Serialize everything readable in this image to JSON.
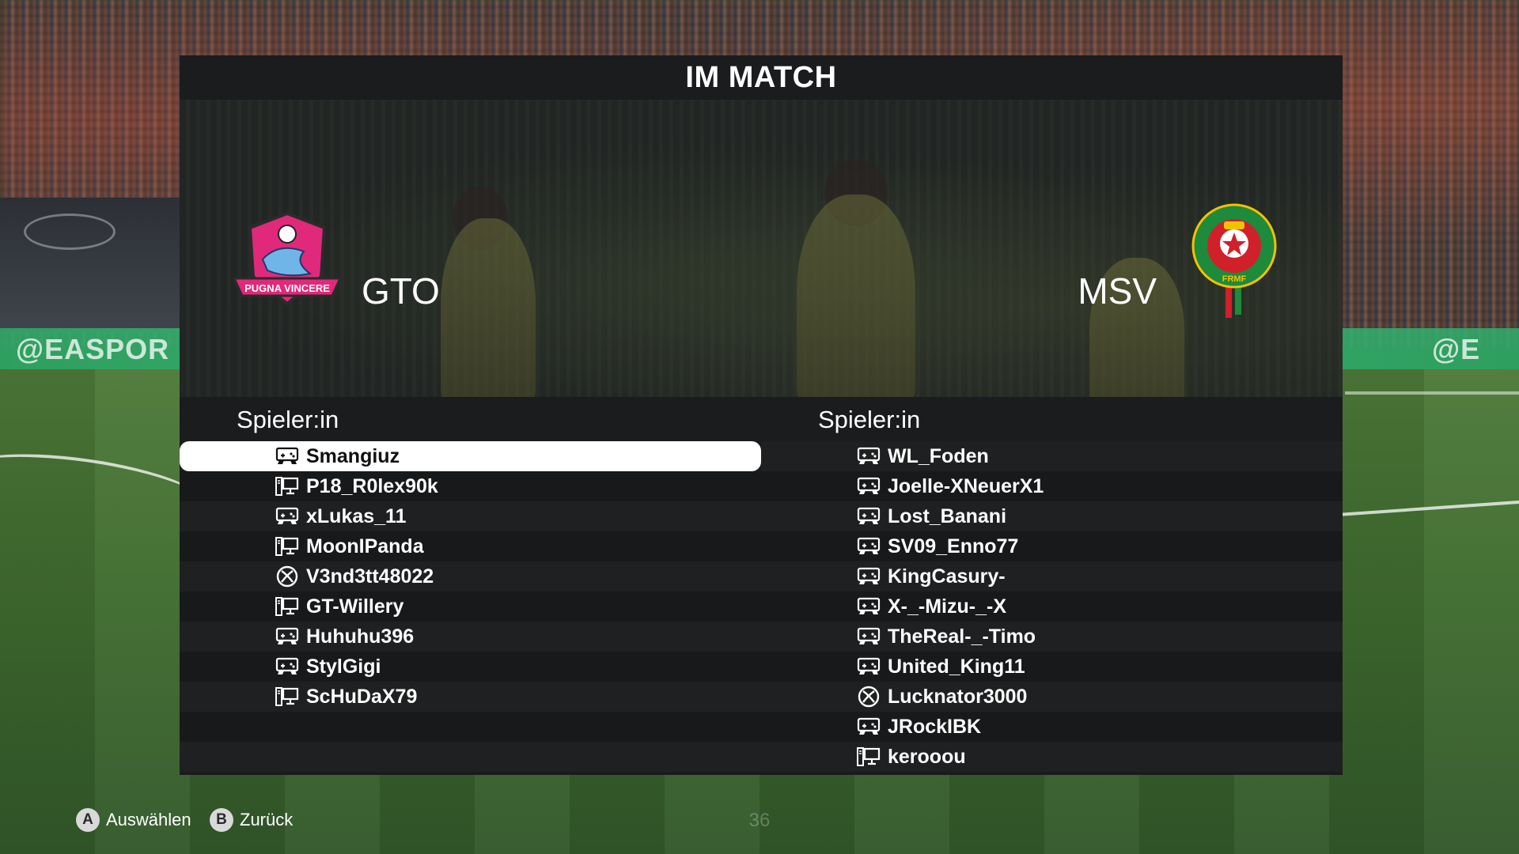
{
  "title": "IM MATCH",
  "teams": {
    "home": {
      "name": "GTO",
      "crest_text": "PUGNA VINCERE",
      "crest_colors": [
        "#e02a7a",
        "#6fb5e8",
        "#2b2b2b"
      ]
    },
    "away": {
      "name": "MSV",
      "crest_text": "FRMF",
      "crest_colors": [
        "#1e8a3c",
        "#d0202a",
        "#f2c200"
      ]
    }
  },
  "columns": {
    "left_header": "Spieler:in",
    "right_header": "Spieler:in"
  },
  "home_players": [
    {
      "name": "Smangiuz",
      "platform": "console-icon",
      "selected": true
    },
    {
      "name": "P18_R0lex90k",
      "platform": "pc-icon"
    },
    {
      "name": "xLukas_11",
      "platform": "console-icon"
    },
    {
      "name": "MoonIPanda",
      "platform": "pc-icon"
    },
    {
      "name": "V3nd3tt48022",
      "platform": "xbox-icon"
    },
    {
      "name": "GT-Willery",
      "platform": "pc-icon"
    },
    {
      "name": "Huhuhu396",
      "platform": "console-icon"
    },
    {
      "name": "StylGigi",
      "platform": "console-icon"
    },
    {
      "name": "ScHuDaX79",
      "platform": "pc-icon"
    }
  ],
  "away_players": [
    {
      "name": "WL_Foden",
      "platform": "console-icon"
    },
    {
      "name": "Joelle-XNeuerX1",
      "platform": "console-icon"
    },
    {
      "name": "Lost_Banani",
      "platform": "console-icon"
    },
    {
      "name": "SV09_Enno77",
      "platform": "console-icon"
    },
    {
      "name": "KingCasury-",
      "platform": "console-icon"
    },
    {
      "name": "X-_-Mizu-_-X",
      "platform": "console-icon"
    },
    {
      "name": "TheReal-_-Timo",
      "platform": "console-icon"
    },
    {
      "name": "United_King11",
      "platform": "console-icon"
    },
    {
      "name": "Lucknator3000",
      "platform": "xbox-icon"
    },
    {
      "name": "JRockIBK",
      "platform": "console-icon"
    },
    {
      "name": "kerooou",
      "platform": "pc-icon"
    }
  ],
  "footer": {
    "select_key": "A",
    "select_label": "Auswählen",
    "back_key": "B",
    "back_label": "Zurück",
    "page_number": "36"
  },
  "background": {
    "ad_text_left": "@EASPOR",
    "ad_text_right": "@E"
  }
}
